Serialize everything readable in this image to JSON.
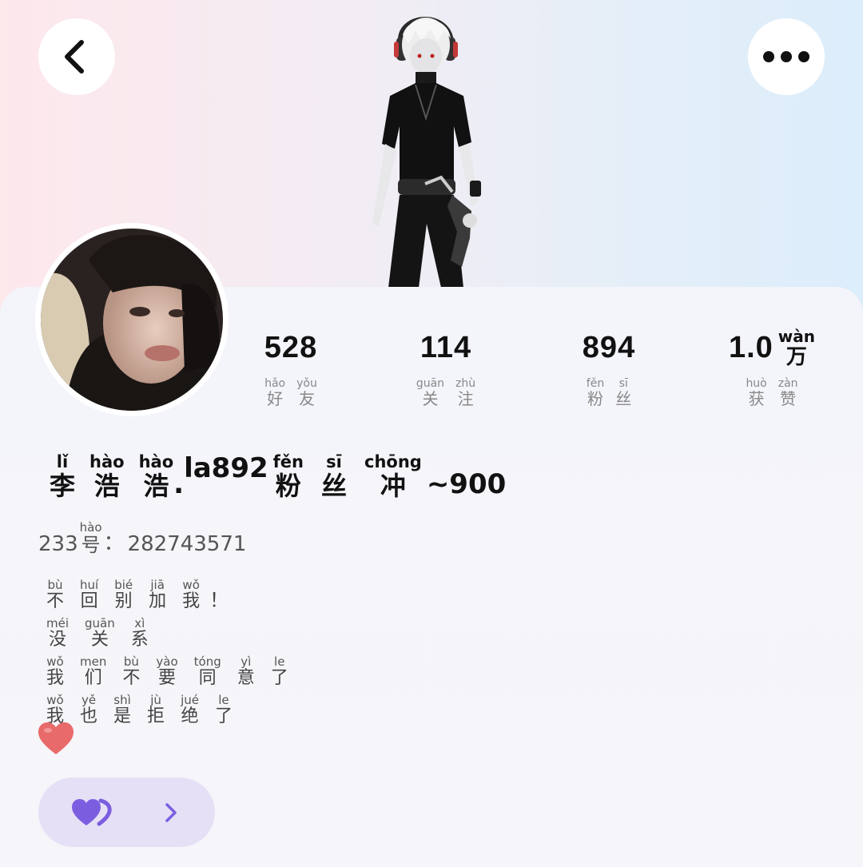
{
  "header": {
    "back_icon": "chevron-left-icon",
    "more_icon": "more-horizontal-icon"
  },
  "stats": [
    {
      "num": "528",
      "label_chars": [
        {
          "p": "hǎo",
          "h": "好"
        },
        {
          "p": "yǒu",
          "h": "友"
        }
      ]
    },
    {
      "num": "114",
      "label_chars": [
        {
          "p": "guān",
          "h": "关"
        },
        {
          "p": "zhù",
          "h": "注"
        }
      ]
    },
    {
      "num": "894",
      "label_chars": [
        {
          "p": "fěn",
          "h": "粉"
        },
        {
          "p": "sī",
          "h": "丝"
        }
      ]
    },
    {
      "num": "1.0",
      "unit": {
        "p": "wàn",
        "h": "万"
      },
      "label_chars": [
        {
          "p": "huò",
          "h": "获"
        },
        {
          "p": "zàn",
          "h": "赞"
        }
      ]
    }
  ],
  "profile": {
    "name": {
      "c1": {
        "p": "lǐ",
        "h": "李"
      },
      "c2": {
        "p": "hào",
        "h": "浩"
      },
      "c3": {
        "p": "hào",
        "h": "浩"
      },
      "dot": ".",
      "seg1": "la892",
      "c4": {
        "p": "fěn",
        "h": "粉"
      },
      "c5": {
        "p": "sī",
        "h": "丝"
      },
      "c6": {
        "p": "chōng",
        "h": "冲"
      },
      "seg2": "~900"
    },
    "id": {
      "prefix": "233",
      "hao": {
        "p": "hào",
        "h": "号"
      },
      "sep": "：",
      "value": "282743571"
    },
    "bio": [
      {
        "chars": [
          {
            "p": "bù",
            "h": "不"
          },
          {
            "p": "huí",
            "h": "回"
          },
          {
            "p": "bié",
            "h": "别"
          },
          {
            "p": "jiā",
            "h": "加"
          },
          {
            "p": "wǒ",
            "h": "我"
          }
        ],
        "tail": "！"
      },
      {
        "chars": [
          {
            "p": "méi",
            "h": "没"
          },
          {
            "p": "guān",
            "h": "关"
          },
          {
            "p": "xì",
            "h": "系"
          }
        ],
        "tail": ""
      },
      {
        "chars": [
          {
            "p": "wǒ",
            "h": "我"
          },
          {
            "p": "men",
            "h": "们"
          },
          {
            "p": "bù",
            "h": "不"
          },
          {
            "p": "yào",
            "h": "要"
          },
          {
            "p": "tóng",
            "h": "同"
          },
          {
            "p": "yì",
            "h": "意"
          },
          {
            "p": "le",
            "h": "了"
          }
        ],
        "tail": ""
      },
      {
        "chars": [
          {
            "p": "wǒ",
            "h": "我"
          },
          {
            "p": "yě",
            "h": "也"
          },
          {
            "p": "shì",
            "h": "是"
          },
          {
            "p": "jù",
            "h": "拒"
          },
          {
            "p": "jué",
            "h": "绝"
          },
          {
            "p": "le",
            "h": "了"
          }
        ],
        "tail": ""
      }
    ],
    "emoji": "red-heart-icon"
  },
  "pill": {
    "icon": "hearts-icon",
    "arrow_icon": "chevron-right-icon"
  },
  "colors": {
    "accent": "#7b5ee0",
    "pill_bg": "#e6e0f7"
  }
}
